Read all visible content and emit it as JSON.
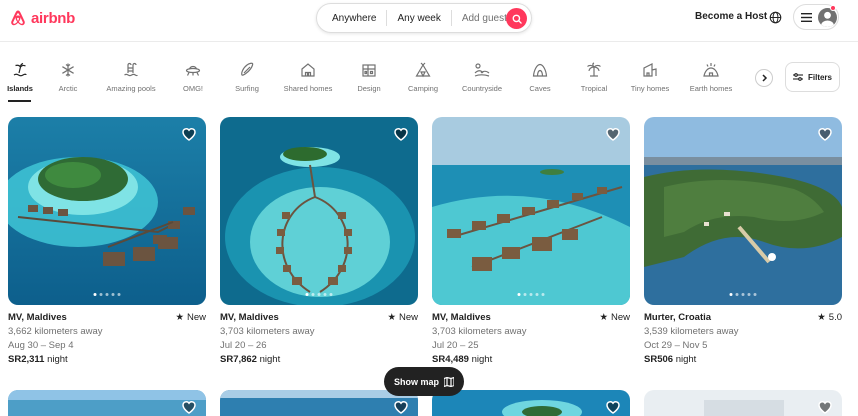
{
  "brand": {
    "name": "airbnb",
    "color": "#ff385c"
  },
  "search": {
    "anywhere": "Anywhere",
    "week": "Any week",
    "guests": "Add guests"
  },
  "header": {
    "become_host": "Become a Host"
  },
  "categories": [
    {
      "label": "Islands",
      "icon": "islands-icon",
      "active": true
    },
    {
      "label": "Arctic",
      "icon": "snowflake-icon"
    },
    {
      "label": "Amazing pools",
      "icon": "pool-icon"
    },
    {
      "label": "OMG!",
      "icon": "ufo-icon"
    },
    {
      "label": "Surfing",
      "icon": "surfboard-icon"
    },
    {
      "label": "Shared homes",
      "icon": "shared-home-icon"
    },
    {
      "label": "Design",
      "icon": "design-building-icon"
    },
    {
      "label": "Camping",
      "icon": "tent-icon"
    },
    {
      "label": "Countryside",
      "icon": "countryside-icon"
    },
    {
      "label": "Caves",
      "icon": "cave-icon"
    },
    {
      "label": "Tropical",
      "icon": "palm-tree-icon"
    },
    {
      "label": "Tiny homes",
      "icon": "tiny-home-icon"
    },
    {
      "label": "Earth homes",
      "icon": "earth-home-icon"
    }
  ],
  "filters_label": "Filters",
  "listings": [
    {
      "title": "MV, Maldives",
      "distance": "3,662 kilometers away",
      "dates": "Aug 30 – Sep 4",
      "price": "SR2,311",
      "per": "night",
      "rating": "New"
    },
    {
      "title": "MV, Maldives",
      "distance": "3,703 kilometers away",
      "dates": "Jul 20 – 26",
      "price": "SR7,862",
      "per": "night",
      "rating": "New"
    },
    {
      "title": "MV, Maldives",
      "distance": "3,703 kilometers away",
      "dates": "Jul 20 – 25",
      "price": "SR4,489",
      "per": "night",
      "rating": "New"
    },
    {
      "title": "Murter, Croatia",
      "distance": "3,539 kilometers away",
      "dates": "Oct 29 – Nov 5",
      "price": "SR506",
      "per": "night",
      "rating": "5.0"
    }
  ],
  "show_map_label": "Show map"
}
